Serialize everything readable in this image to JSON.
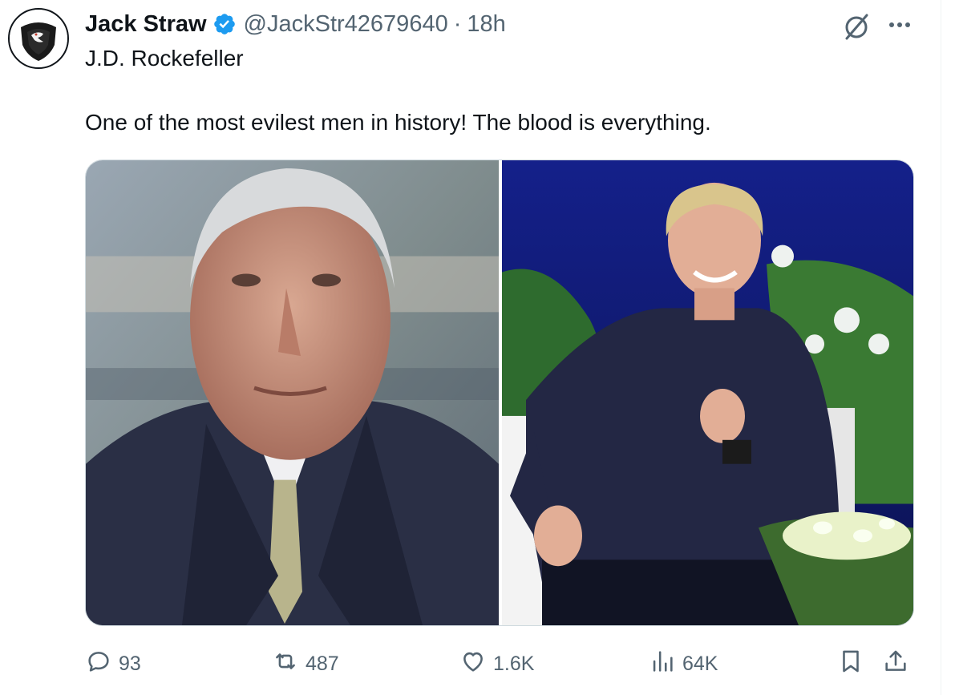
{
  "tweet": {
    "author_name": "Jack Straw",
    "author_handle": "@JackStr42679640",
    "separator": "·",
    "timestamp": "18h",
    "subtitle": "J.D. Rockefeller",
    "text": "One of the most evilest men in history! The blood is everything."
  },
  "icons": {
    "verified": "verified-badge-icon",
    "grok": "grok-icon",
    "more": "more-options-icon",
    "reply": "reply-icon",
    "repost": "repost-icon",
    "like": "like-icon",
    "views": "views-icon",
    "bookmark": "bookmark-icon",
    "share": "share-icon"
  },
  "stats": {
    "replies": "93",
    "reposts": "487",
    "likes": "1.6K",
    "views": "64K"
  },
  "colors": {
    "verified_blue": "#1d9bf0",
    "secondary_text": "#536471",
    "primary_text": "#0f1419"
  }
}
